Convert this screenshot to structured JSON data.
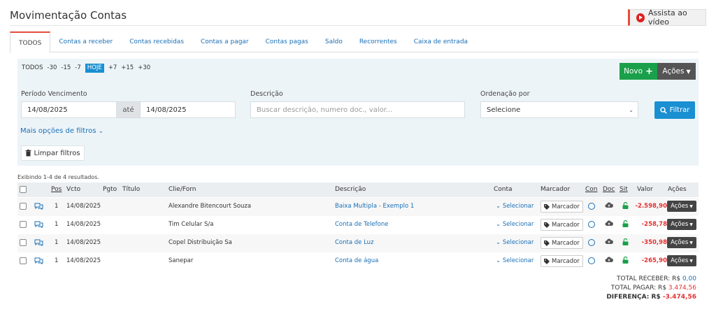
{
  "page": {
    "title": "Movimentação Contas",
    "video_label": "Assista ao vídeo"
  },
  "tabs": [
    "TODOS",
    "Contas a receber",
    "Contas recebidas",
    "Contas a pagar",
    "Contas pagas",
    "Saldo",
    "Recorrentes",
    "Caixa de entrada"
  ],
  "quick_filters": [
    "TODOS",
    "-30",
    "-15",
    "-7",
    "HOJE",
    "+7",
    "+15",
    "+30"
  ],
  "toolbar": {
    "novo": "Novo",
    "acoes": "Ações"
  },
  "filters": {
    "periodo_label": "Período Vencimento",
    "date_from": "14/08/2025",
    "ate": "até",
    "date_to": "14/08/2025",
    "descricao_label": "Descrição",
    "descricao_placeholder": "Buscar descrição, numero doc., valor...",
    "ordenacao_label": "Ordenação por",
    "ordenacao_value": "Selecione",
    "filtrar": "Filtrar",
    "more": "Mais opções de filtros",
    "limpar": "Limpar filtros"
  },
  "results": "Exibindo 1-4 de 4 resultados.",
  "table": {
    "headers": {
      "pos": "Pos",
      "vcto": "Vcto",
      "pgto": "Pgto",
      "titulo": "Título",
      "cliforn": "Clie/Forn",
      "descricao": "Descrição",
      "conta": "Conta",
      "marcador": "Marcador",
      "con": "Con",
      "doc": "Doc",
      "sit": "Sit",
      "valor": "Valor",
      "acoes": "Ações"
    },
    "rows": [
      {
        "pos": "1",
        "vcto": "14/08/2025",
        "cliforn": "Alexandre Bitencourt Souza",
        "descricao": "Baixa Multipla - Exemplo 1",
        "conta": "Selecionar",
        "marcador": "Marcador",
        "valor": "-2.598,90",
        "acoes": "Ações"
      },
      {
        "pos": "1",
        "vcto": "14/08/2025",
        "cliforn": "Tim Celular S/a",
        "descricao": "Conta de Telefone",
        "conta": "Selecionar",
        "marcador": "Marcador",
        "valor": "-258,78",
        "acoes": "Ações"
      },
      {
        "pos": "1",
        "vcto": "14/08/2025",
        "cliforn": "Copel Distribuição Sa",
        "descricao": "Conta de Luz",
        "conta": "Selecionar",
        "marcador": "Marcador",
        "valor": "-350,98",
        "acoes": "Ações"
      },
      {
        "pos": "1",
        "vcto": "14/08/2025",
        "cliforn": "Sanepar",
        "descricao": "Conta de água",
        "conta": "Selecionar",
        "marcador": "Marcador",
        "valor": "-265,90",
        "acoes": "Ações"
      }
    ]
  },
  "totals": {
    "receber_label": "TOTAL RECEBER: R$",
    "receber_value": "0,00",
    "pagar_label": "TOTAL PAGAR: R$",
    "pagar_value": "3.474,56",
    "diferenca_label": "DIFERENÇA: R$",
    "diferenca_value": "-3.474,56"
  },
  "colors": {
    "accent": "#1a8fd1",
    "success": "#1aa04a",
    "danger": "#e53030",
    "link": "#1a6fb5"
  }
}
